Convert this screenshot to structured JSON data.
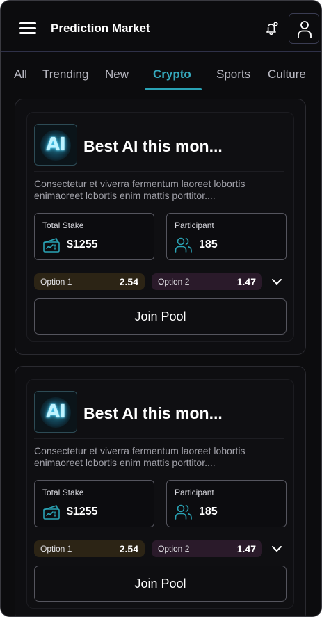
{
  "header": {
    "title": "Prediction Market"
  },
  "tabs": [
    {
      "label": "All"
    },
    {
      "label": "Trending"
    },
    {
      "label": "New"
    },
    {
      "label": "Crypto"
    },
    {
      "label": "Sports"
    },
    {
      "label": "Culture"
    }
  ],
  "active_tab": "Crypto",
  "colors": {
    "accent": "#2aa3b5",
    "option1_bg": "#2c2415",
    "option2_bg": "#2a1a2a"
  },
  "cards": [
    {
      "logo_text": "AI",
      "title": "Best AI this mon...",
      "description": "Consectetur et viverra fermentum laoreet lobortis enimaoreet lobortis enim mattis porttitor....",
      "stake_label": "Total Stake",
      "stake_value": "$1255",
      "participant_label": "Participant",
      "participant_value": "185",
      "option1_label": "Option 1",
      "option1_odds": "2.54",
      "option2_label": "Option 2",
      "option2_odds": "1.47",
      "join_label": "Join Pool"
    },
    {
      "logo_text": "AI",
      "title": "Best AI this mon...",
      "description": "Consectetur et viverra fermentum laoreet lobortis enimaoreet lobortis enim mattis porttitor....",
      "stake_label": "Total Stake",
      "stake_value": "$1255",
      "participant_label": "Participant",
      "participant_value": "185",
      "option1_label": "Option 1",
      "option1_odds": "2.54",
      "option2_label": "Option 2",
      "option2_odds": "1.47",
      "join_label": "Join Pool"
    }
  ]
}
